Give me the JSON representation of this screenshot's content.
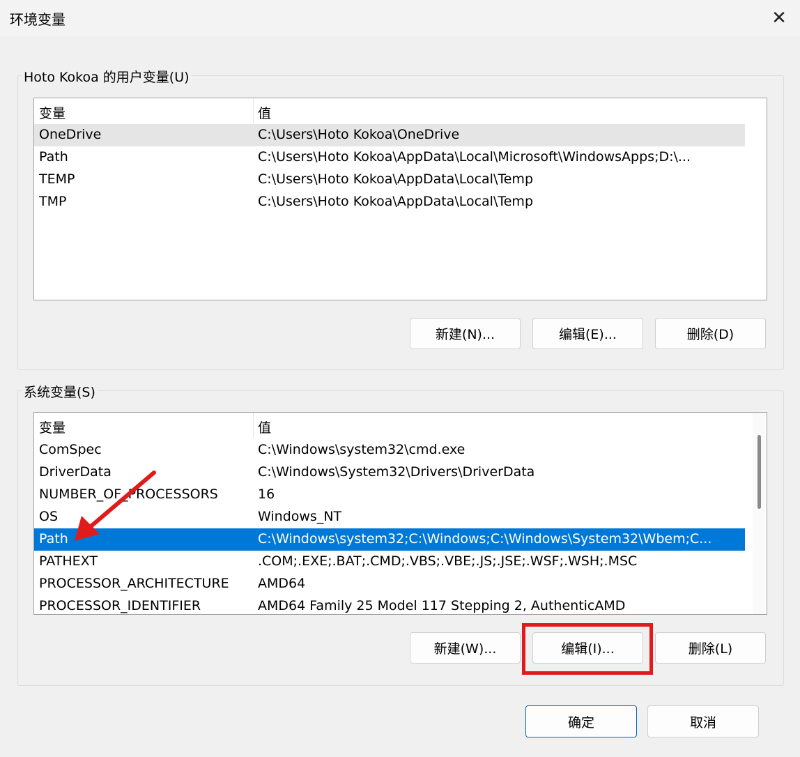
{
  "window": {
    "title": "环境变量",
    "close_glyph": "✕"
  },
  "user_vars": {
    "group_label": "Hoto Kokoa 的用户变量(U)",
    "col_name": "变量",
    "col_value": "值",
    "rows": [
      {
        "name": "OneDrive",
        "value": "C:\\Users\\Hoto Kokoa\\OneDrive"
      },
      {
        "name": "Path",
        "value": "C:\\Users\\Hoto Kokoa\\AppData\\Local\\Microsoft\\WindowsApps;D:\\..."
      },
      {
        "name": "TEMP",
        "value": "C:\\Users\\Hoto Kokoa\\AppData\\Local\\Temp"
      },
      {
        "name": "TMP",
        "value": "C:\\Users\\Hoto Kokoa\\AppData\\Local\\Temp"
      }
    ],
    "buttons": {
      "new": "新建(N)...",
      "edit": "编辑(E)...",
      "delete": "删除(D)"
    }
  },
  "system_vars": {
    "group_label": "系统变量(S)",
    "col_name": "变量",
    "col_value": "值",
    "rows": [
      {
        "name": "ComSpec",
        "value": "C:\\Windows\\system32\\cmd.exe"
      },
      {
        "name": "DriverData",
        "value": "C:\\Windows\\System32\\Drivers\\DriverData"
      },
      {
        "name": "NUMBER_OF_PROCESSORS",
        "value": "16"
      },
      {
        "name": "OS",
        "value": "Windows_NT"
      },
      {
        "name": "Path",
        "value": "C:\\Windows\\system32;C:\\Windows;C:\\Windows\\System32\\Wbem;C..."
      },
      {
        "name": "PATHEXT",
        "value": ".COM;.EXE;.BAT;.CMD;.VBS;.VBE;.JS;.JSE;.WSF;.WSH;.MSC"
      },
      {
        "name": "PROCESSOR_ARCHITECTURE",
        "value": "AMD64"
      },
      {
        "name": "PROCESSOR_IDENTIFIER",
        "value": "AMD64 Family 25 Model 117 Stepping 2, AuthenticAMD"
      }
    ],
    "buttons": {
      "new": "新建(W)...",
      "edit": "编辑(I)...",
      "delete": "删除(L)"
    }
  },
  "footer": {
    "ok": "确定",
    "cancel": "取消"
  },
  "annotation_colors": {
    "arrow": "#e01b1b",
    "box": "#e01b1b"
  },
  "selection_color": "#0078d7"
}
